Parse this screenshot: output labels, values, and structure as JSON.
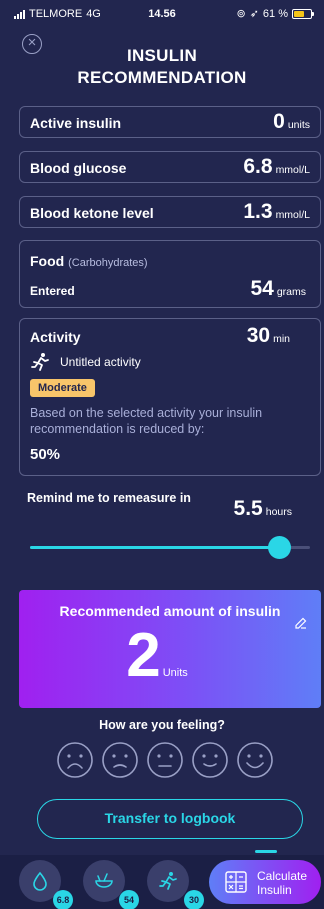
{
  "status_bar": {
    "carrier": "TELMORE",
    "network": "4G",
    "time": "14.56",
    "battery": "61 %"
  },
  "title_lines": [
    "INSULIN",
    "RECOMMENDATION"
  ],
  "active_insulin": {
    "label": "Active insulin",
    "value": "0",
    "unit": "units"
  },
  "blood_glucose": {
    "label": "Blood glucose",
    "value": "6.8",
    "unit": "mmol/L"
  },
  "blood_ketone": {
    "label": "Blood ketone level",
    "value": "1.3",
    "unit": "mmol/L"
  },
  "food": {
    "label": "Food",
    "sublabel": "(Carbohydrates)",
    "entered_label": "Entered",
    "value": "54",
    "unit": "grams"
  },
  "activity": {
    "label": "Activity",
    "value": "30",
    "unit": "min",
    "name": "Untitled activity",
    "intensity": "Moderate",
    "description": "Based on the selected activity your insulin recommendation is reduced by:",
    "reduction": "50%"
  },
  "remind": {
    "label": "Remind me to remeasure in",
    "value": "5.5",
    "unit": "hours",
    "slider_fraction": 0.89
  },
  "recommendation": {
    "title": "Recommended amount of insulin",
    "value": "2",
    "unit": "Units"
  },
  "feeling": {
    "question": "How are you feeling?"
  },
  "transfer_label": "Transfer to logbook",
  "bottom_nav": {
    "glucose_badge": "6.8",
    "food_badge": "54",
    "activity_badge": "30",
    "calculate_label_1": "Calculate",
    "calculate_label_2": "Insulin"
  },
  "colors": {
    "background": "#22264f",
    "accent": "#2ad6e6",
    "badge": "#f8c56a"
  }
}
